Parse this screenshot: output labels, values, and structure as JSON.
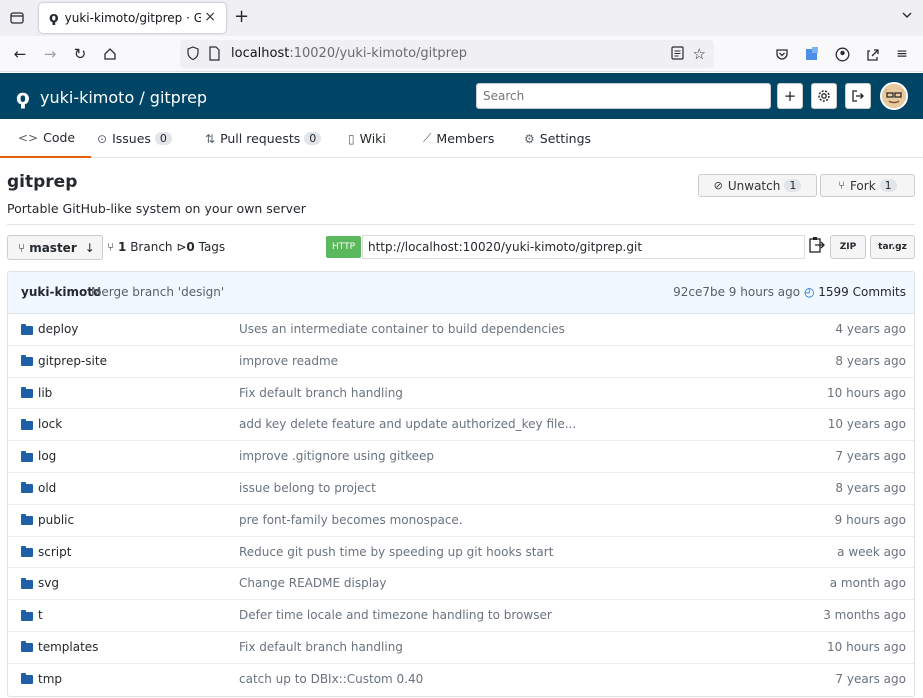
{
  "browser": {
    "tab_title": "yuki-kimoto/gitprep · Git",
    "url_host": "localhost",
    "url_path": ":10020/yuki-kimoto/gitprep"
  },
  "header": {
    "repo_title": "yuki-kimoto / gitprep",
    "search_placeholder": "Search"
  },
  "tabs": [
    {
      "label": "Code",
      "icon": "code-icon"
    },
    {
      "label": "Issues",
      "count": "0",
      "icon": "issue-icon"
    },
    {
      "label": "Pull requests",
      "count": "0",
      "icon": "pull-request-icon"
    },
    {
      "label": "Wiki",
      "icon": "book-icon"
    },
    {
      "label": "Members",
      "icon": "graph-icon"
    },
    {
      "label": "Settings",
      "icon": "gear-icon"
    }
  ],
  "repo": {
    "name": "gitprep",
    "description": "Portable GitHub-like system on your own server",
    "unwatch_label": "Unwatch",
    "watch_count": "1",
    "fork_label": "Fork",
    "fork_count": "1",
    "branch": "master",
    "branch_count": "1",
    "branch_label": "Branch",
    "tag_count": "0",
    "tag_label": "Tags",
    "protocol": "HTTP",
    "clone_url": "http://localhost:10020/yuki-kimoto/gitprep.git",
    "zip_label": "ZIP",
    "targz_label": "tar.gz"
  },
  "latest_commit": {
    "author": "yuki-kimoto",
    "message": "Merge branch 'design'",
    "hash_age": "92ce7be 9 hours ago",
    "commits": "1599 Commits"
  },
  "files": [
    {
      "name": "deploy",
      "message": "Uses an intermediate container to build dependencies",
      "age": "4 years ago"
    },
    {
      "name": "gitprep-site",
      "message": "improve readme",
      "age": "8 years ago"
    },
    {
      "name": "lib",
      "message": "Fix default branch handling",
      "age": "10 hours ago"
    },
    {
      "name": "lock",
      "message": "add key delete feature and update authorized_key file...",
      "age": "10 years ago"
    },
    {
      "name": "log",
      "message": "improve .gitignore using gitkeep",
      "age": "7 years ago"
    },
    {
      "name": "old",
      "message": "issue belong to project",
      "age": "8 years ago"
    },
    {
      "name": "public",
      "message": "pre font-family becomes monospace.",
      "age": "9 hours ago"
    },
    {
      "name": "script",
      "message": "Reduce git push time by speeding up git hooks start",
      "age": "a week ago"
    },
    {
      "name": "svg",
      "message": "Change README display",
      "age": "a month ago"
    },
    {
      "name": "t",
      "message": "Defer time locale and timezone handling to browser",
      "age": "3 months ago"
    },
    {
      "name": "templates",
      "message": "Fix default branch handling",
      "age": "10 hours ago"
    },
    {
      "name": "tmp",
      "message": "catch up to DBIx::Custom 0.40",
      "age": "7 years ago"
    }
  ]
}
